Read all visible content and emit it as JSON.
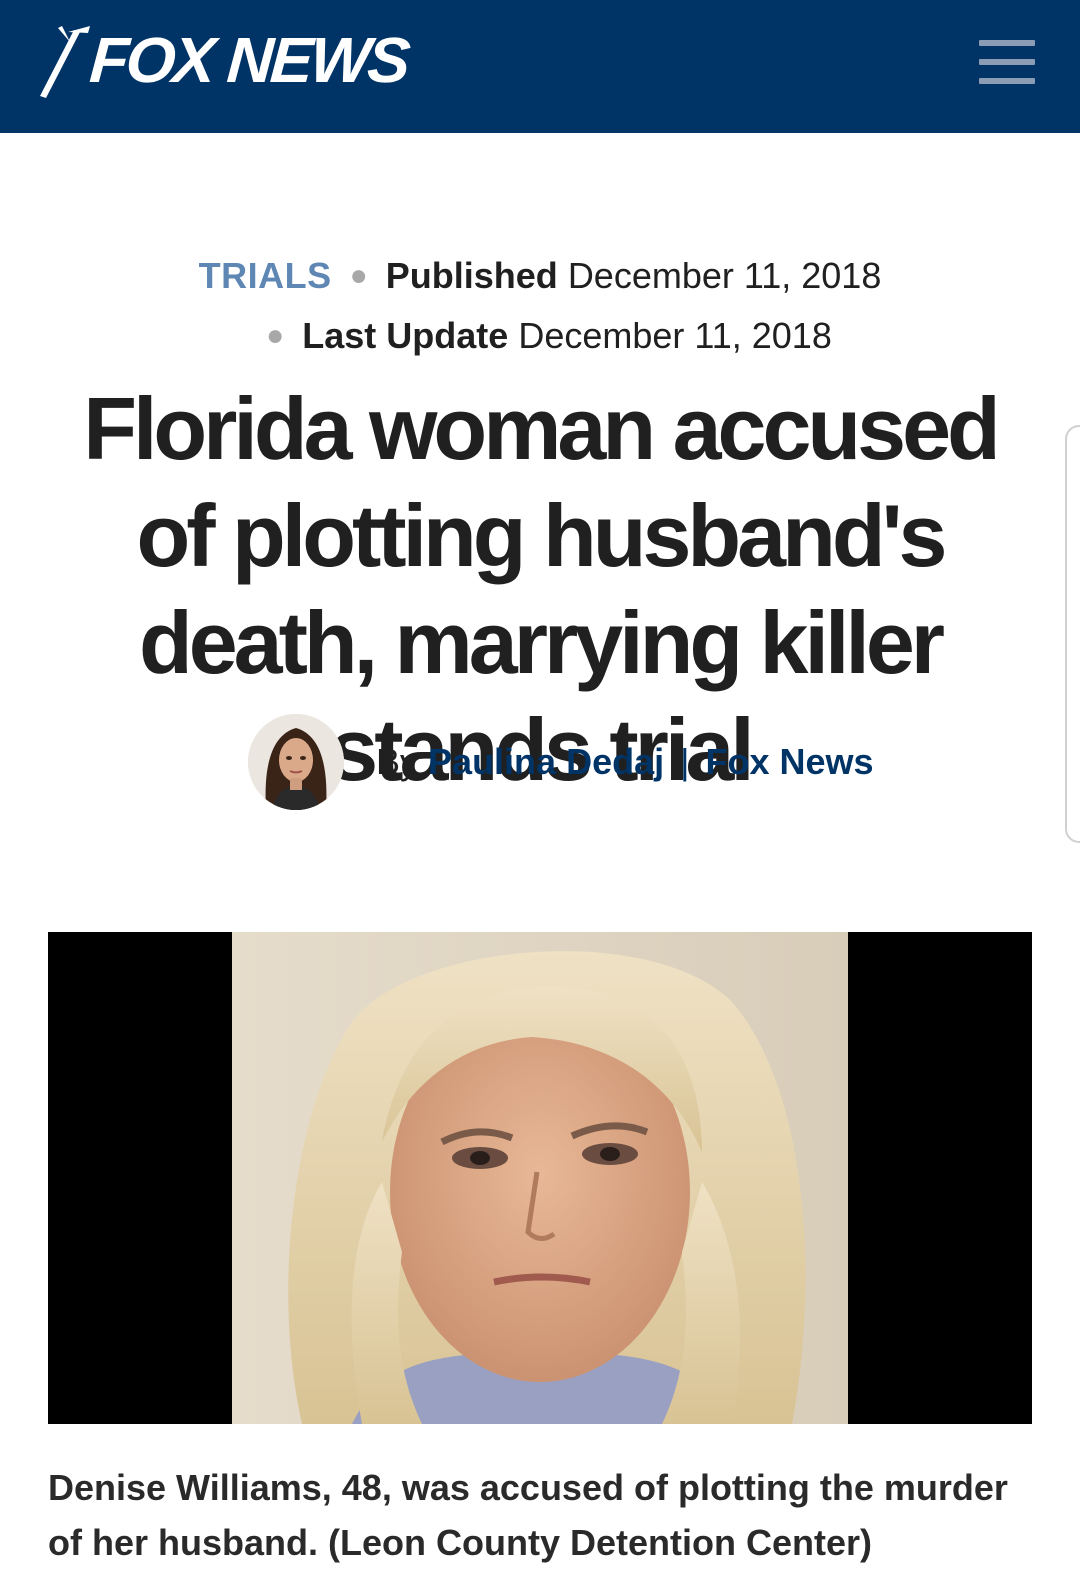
{
  "header": {
    "logo_text": "FOX NEWS",
    "brand_color": "#003366",
    "menu_icon": "hamburger-menu-icon"
  },
  "article": {
    "category": "TRIALS",
    "published_label": "Published",
    "published_date": "December 11, 2018",
    "updated_label": "Last Update",
    "updated_date": "December 11, 2018",
    "headline": "Florida woman accused of plotting husband's death, marrying killer stands trial",
    "byline": {
      "prefix": "By",
      "author": "Paulina Dedaj",
      "separator": "|",
      "outlet": "Fox News"
    },
    "image_caption": "Denise Williams, 48, was accused of plotting the murder of her husband. (Leon County Detention Center)"
  },
  "colors": {
    "category": "#5f87b3",
    "link": "#003366",
    "text": "#202020"
  }
}
